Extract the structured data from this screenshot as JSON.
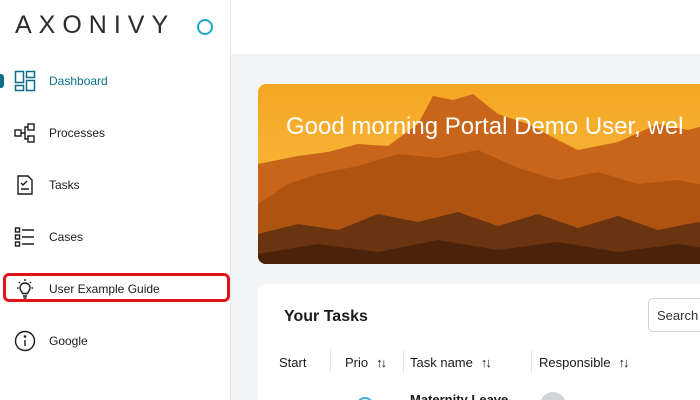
{
  "sidebar": {
    "logo": "AXONIVY",
    "items": [
      {
        "label": "Dashboard",
        "icon": "dashboard-icon"
      },
      {
        "label": "Processes",
        "icon": "processes-icon"
      },
      {
        "label": "Tasks",
        "icon": "tasks-icon"
      },
      {
        "label": "Cases",
        "icon": "cases-icon"
      },
      {
        "label": "User Example Guide",
        "icon": "lightbulb-icon"
      },
      {
        "label": "Google",
        "icon": "info-icon"
      }
    ],
    "active_item": "Dashboard",
    "highlighted_item": "User Example Guide"
  },
  "banner": {
    "greeting": "Good morning Portal Demo User, wel"
  },
  "tasks_widget": {
    "title": "Your Tasks",
    "search_placeholder": "Search",
    "columns": [
      "Start",
      "Prio",
      "Task name",
      "Responsible"
    ],
    "first_row_task": "Maternity Leave"
  },
  "colors": {
    "accent": "#0d6e8a",
    "logo_dot": "#1aa7c9",
    "highlight_border": "#e0141b",
    "banner_sky": "#f5a623"
  }
}
